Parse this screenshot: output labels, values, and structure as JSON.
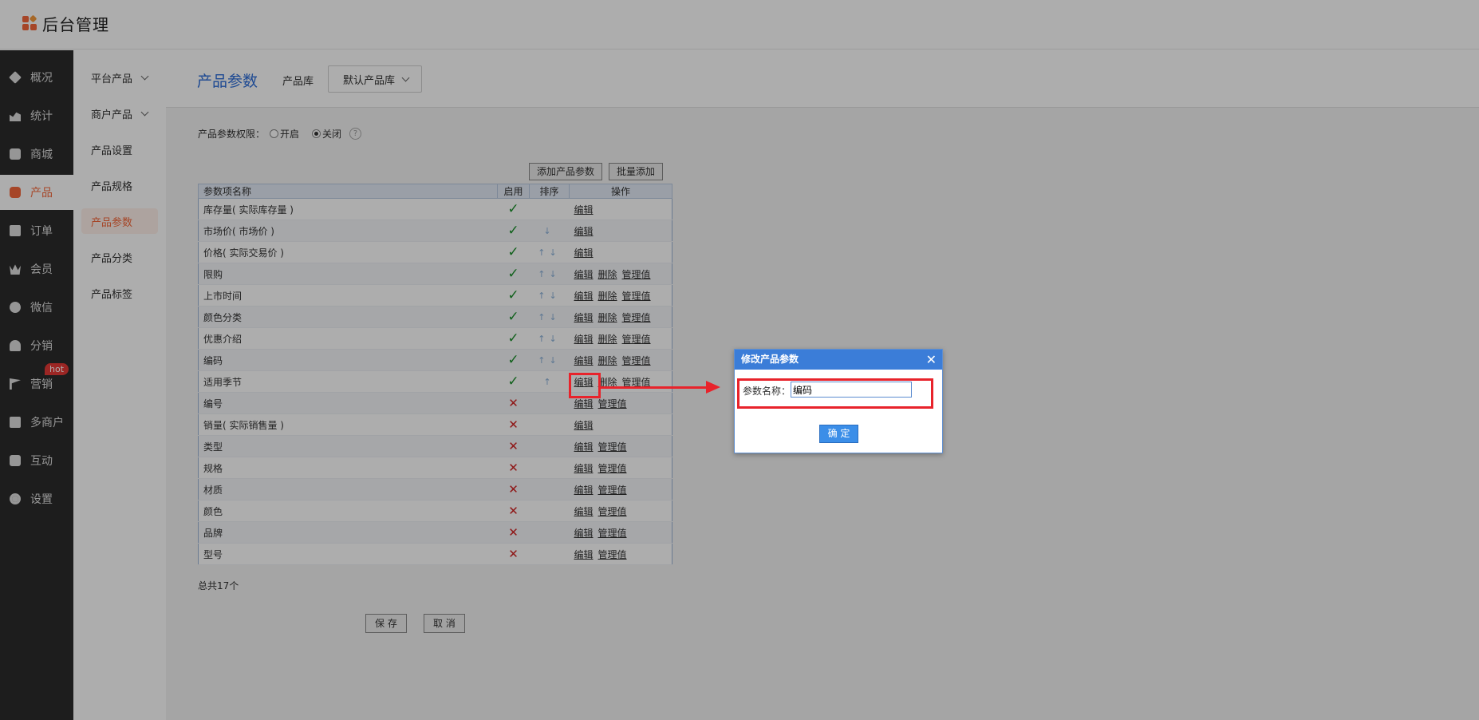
{
  "app": {
    "title": "后台管理"
  },
  "sidebar": {
    "items": [
      {
        "label": "概况",
        "icon": "layers-icon"
      },
      {
        "label": "统计",
        "icon": "chart-icon"
      },
      {
        "label": "商城",
        "icon": "store-icon"
      },
      {
        "label": "产品",
        "icon": "grid-icon"
      },
      {
        "label": "订单",
        "icon": "order-icon"
      },
      {
        "label": "会员",
        "icon": "crown-icon"
      },
      {
        "label": "微信",
        "icon": "wechat-icon"
      },
      {
        "label": "分销",
        "icon": "users-icon"
      },
      {
        "label": "营销",
        "icon": "flag-icon"
      },
      {
        "label": "多商户",
        "icon": "multi-store-icon"
      },
      {
        "label": "互动",
        "icon": "interact-icon"
      },
      {
        "label": "设置",
        "icon": "gear-icon"
      }
    ],
    "hot_badge": "hot",
    "active_color": "#f5683b"
  },
  "submenu": {
    "items": [
      {
        "label": "平台产品"
      },
      {
        "label": "商户产品"
      },
      {
        "label": "产品设置"
      },
      {
        "label": "产品规格"
      },
      {
        "label": "产品参数"
      },
      {
        "label": "产品分类"
      },
      {
        "label": "产品标签"
      }
    ]
  },
  "header": {
    "title": "产品参数",
    "library_label": "产品库",
    "library_value": "默认产品库"
  },
  "permission": {
    "label": "产品参数权限：",
    "on": "开启",
    "off": "关闭",
    "help": "?"
  },
  "toolbar": {
    "add_label": "添加产品参数",
    "batch_label": "批量添加"
  },
  "table": {
    "headers": [
      "参数项名称",
      "启用",
      "排序",
      "操作"
    ],
    "rows": [
      {
        "name": "库存量( 实际库存量 )",
        "enabled": "✓",
        "sort": "",
        "ops": [
          "编辑"
        ]
      },
      {
        "name": "市场价( 市场价 )",
        "enabled": "✓",
        "sort": "↓",
        "ops": [
          "编辑"
        ]
      },
      {
        "name": "价格( 实际交易价 )",
        "enabled": "✓",
        "sort": "↑↓",
        "ops": [
          "编辑"
        ]
      },
      {
        "name": "限购",
        "enabled": "✓",
        "sort": "↑↓",
        "ops": [
          "编辑",
          "删除",
          "管理值"
        ]
      },
      {
        "name": "上市时间",
        "enabled": "✓",
        "sort": "↑↓",
        "ops": [
          "编辑",
          "删除",
          "管理值"
        ]
      },
      {
        "name": "颜色分类",
        "enabled": "✓",
        "sort": "↑↓",
        "ops": [
          "编辑",
          "删除",
          "管理值"
        ]
      },
      {
        "name": "优惠介绍",
        "enabled": "✓",
        "sort": "↑↓",
        "ops": [
          "编辑",
          "删除",
          "管理值"
        ]
      },
      {
        "name": "编码",
        "enabled": "✓",
        "sort": "↑↓",
        "ops": [
          "编辑",
          "删除",
          "管理值"
        ]
      },
      {
        "name": "适用季节",
        "enabled": "✓",
        "sort": "↑",
        "ops": [
          "编辑",
          "删除",
          "管理值"
        ]
      },
      {
        "name": "编号",
        "enabled": "✕",
        "sort": "",
        "ops": [
          "编辑",
          "管理值"
        ]
      },
      {
        "name": "销量( 实际销售量 )",
        "enabled": "✕",
        "sort": "",
        "ops": [
          "编辑"
        ]
      },
      {
        "name": "类型",
        "enabled": "✕",
        "sort": "",
        "ops": [
          "编辑",
          "管理值"
        ]
      },
      {
        "name": "规格",
        "enabled": "✕",
        "sort": "",
        "ops": [
          "编辑",
          "管理值"
        ]
      },
      {
        "name": "材质",
        "enabled": "✕",
        "sort": "",
        "ops": [
          "编辑",
          "管理值"
        ]
      },
      {
        "name": "颜色",
        "enabled": "✕",
        "sort": "",
        "ops": [
          "编辑",
          "管理值"
        ]
      },
      {
        "name": "品牌",
        "enabled": "✕",
        "sort": "",
        "ops": [
          "编辑",
          "管理值"
        ]
      },
      {
        "name": "型号",
        "enabled": "✕",
        "sort": "",
        "ops": [
          "编辑",
          "管理值"
        ]
      }
    ]
  },
  "footer": {
    "total": "总共17个",
    "save_label": "保 存",
    "cancel_label": "取 消"
  },
  "dialog": {
    "title": "修改产品参数",
    "close": "✕",
    "field_label": "参数名称：",
    "field_value": "编码",
    "ok_label": "确 定"
  }
}
